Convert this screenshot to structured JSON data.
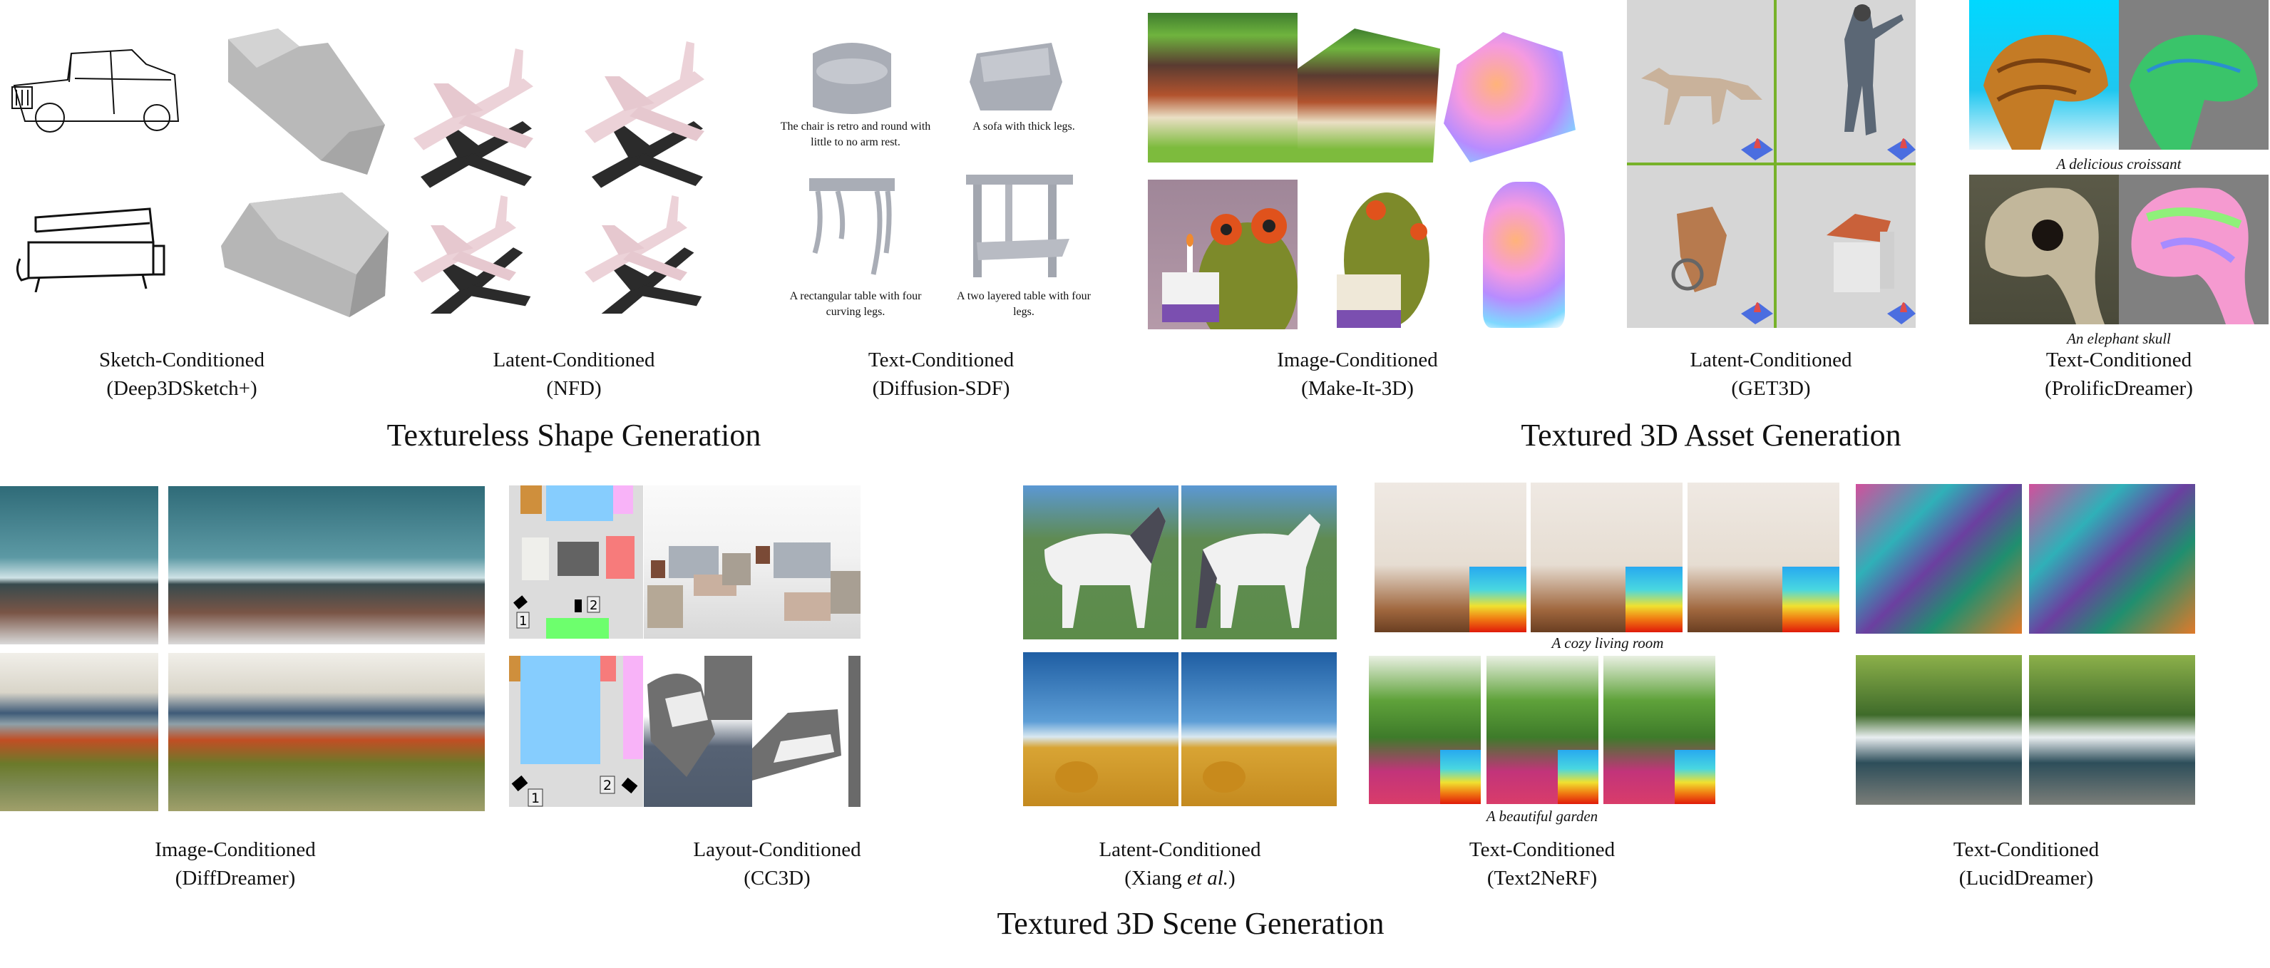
{
  "figure": {
    "sections": [
      {
        "title": "Textureless Shape Generation",
        "panels": [
          {
            "condition": "Sketch-Conditioned",
            "method": "(Deep3DSketch+)",
            "content": [
              "car sketch",
              "car mesh",
              "sofa sketch",
              "sofa mesh"
            ]
          },
          {
            "condition": "Latent-Conditioned",
            "method": "(NFD)",
            "content": [
              "airplane with shadow x4"
            ]
          },
          {
            "condition": "Text-Conditioned",
            "method": "(Diffusion-SDF)",
            "prompts": [
              "The chair is retro and round with little to no arm rest.",
              "A sofa with thick legs.",
              "A rectangular table with four curving legs.",
              "A two layered table with four legs."
            ]
          }
        ]
      },
      {
        "title": "Textured 3D Asset Generation",
        "panels": [
          {
            "condition": "Image-Conditioned",
            "method": "(Make-It-3D)",
            "content": [
              "house input",
              "house textured",
              "house normal",
              "frog input",
              "frog textured",
              "frog normal"
            ]
          },
          {
            "condition": "Latent-Conditioned",
            "method": "(GET3D)",
            "content": [
              "fox",
              "person",
              "motorbike",
              "house"
            ]
          },
          {
            "condition": "Text-Conditioned",
            "method": "(ProlificDreamer)",
            "prompts": [
              "A delicious croissant",
              "An elephant skull"
            ]
          }
        ]
      },
      {
        "title": "Textured 3D Scene Generation",
        "panels": [
          {
            "condition": "Image-Conditioned",
            "method": "(DiffDreamer)",
            "content": [
              "coast views x3",
              "autumn views x3"
            ]
          },
          {
            "condition": "Layout-Conditioned",
            "method": "(CC3D)",
            "camera_labels": [
              "1",
              "2"
            ],
            "content": [
              "living room layout",
              "living room renders",
              "bedroom layout",
              "bedroom renders"
            ]
          },
          {
            "condition": "Latent-Conditioned",
            "method_prefix": "(Xiang ",
            "method_italic": "et al.",
            "method_suffix": ")",
            "content": [
              "horse x2",
              "hay bale field x2"
            ]
          },
          {
            "condition": "Text-Conditioned",
            "method": "(Text2NeRF)",
            "prompts": [
              "A cozy living room",
              "A beautiful garden"
            ]
          },
          {
            "condition": "Text-Conditioned",
            "method": "(LucidDreamer)",
            "content": [
              "fantasy castle x2",
              "waterfall x2"
            ]
          }
        ]
      }
    ],
    "colors": {
      "layout_orange": "#cf8f3c",
      "layout_blue": "#86cdfe",
      "layout_pink": "#f8b3f8",
      "layout_white": "#efefeb",
      "layout_dark": "#636363",
      "layout_red": "#f77b7b",
      "layout_green": "#6dff6d",
      "get3d_divider": "#77b22a"
    }
  }
}
